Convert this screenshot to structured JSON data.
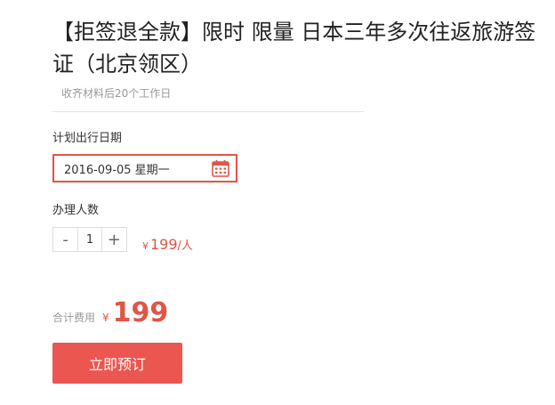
{
  "product": {
    "title": "【拒签退全款】限时 限量 日本三年多次往返旅游签证（北京领区）",
    "processing_note": "收齐材料后20个工作日"
  },
  "travel_date": {
    "label": "计划出行日期",
    "value": "2016-09-05 星期一",
    "icon": "calendar-icon"
  },
  "applicants": {
    "label": "办理人数",
    "minus_label": "-",
    "count": "1",
    "plus_label": "+"
  },
  "unit_price": {
    "currency": "¥",
    "amount": "199",
    "per": "/人"
  },
  "total": {
    "label": "合计费用",
    "currency": "¥",
    "amount": "199"
  },
  "actions": {
    "book_label": "立即预订"
  },
  "colors": {
    "accent": "#e05545",
    "button_bg": "#ec5650"
  }
}
